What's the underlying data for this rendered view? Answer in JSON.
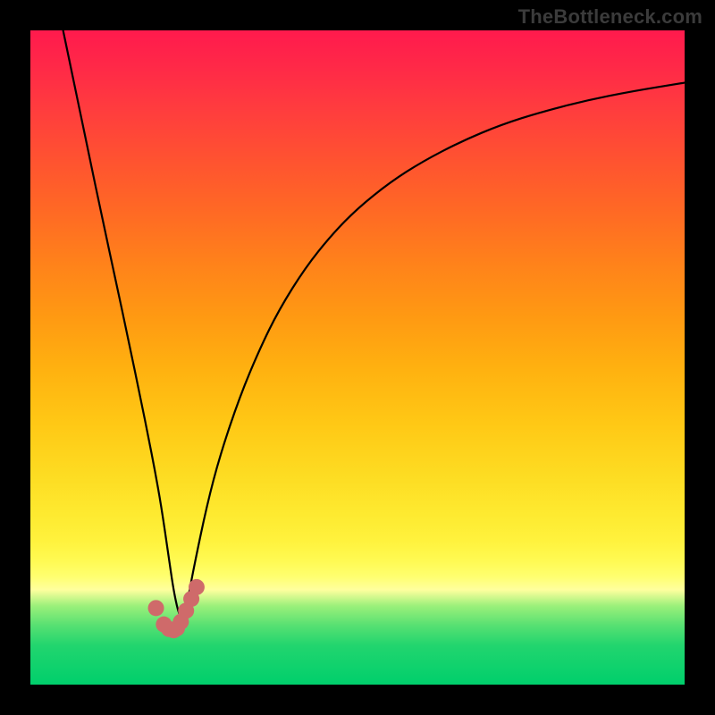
{
  "watermark": "TheBottleneck.com",
  "colors": {
    "curve": "#000000",
    "dots": "#cf6a6a",
    "frame_bg": "#000000"
  },
  "chart_data": {
    "type": "line",
    "title": "",
    "xlabel": "",
    "ylabel": "",
    "xlim": [
      0,
      100
    ],
    "ylim": [
      0,
      100
    ],
    "x": [
      5,
      7,
      9,
      11,
      13,
      15,
      17,
      18,
      19,
      20,
      21,
      22,
      23,
      24,
      25,
      27,
      29,
      32,
      35,
      38,
      42,
      46,
      50,
      55,
      60,
      66,
      72,
      78,
      85,
      92,
      100
    ],
    "values": [
      100,
      90.4,
      80.8,
      71.2,
      62,
      52.6,
      43,
      38,
      32.9,
      27.3,
      20.5,
      13.6,
      9.7,
      12.6,
      18,
      27.5,
      35.1,
      44,
      51.2,
      57.3,
      63.7,
      68.7,
      72.8,
      76.8,
      80,
      83.1,
      85.6,
      87.5,
      89.3,
      90.7,
      92
    ],
    "grid": false,
    "legend": false,
    "markers": {
      "x": [
        19.2,
        20.4,
        21.2,
        21.9,
        22.4,
        23.0,
        23.8,
        24.6,
        25.4
      ],
      "y": [
        11.7,
        9.2,
        8.5,
        8.3,
        8.6,
        9.6,
        11.3,
        13.1,
        14.9
      ],
      "radius_px": 9
    }
  }
}
